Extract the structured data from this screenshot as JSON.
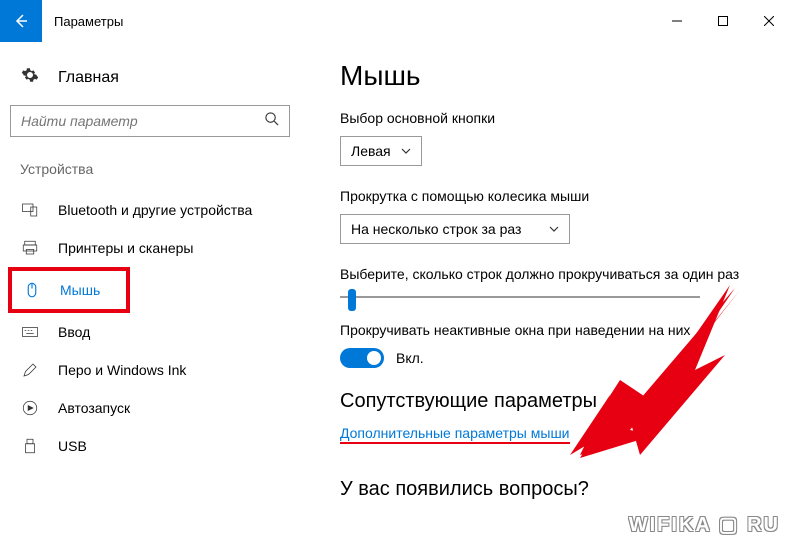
{
  "titlebar": {
    "title": "Параметры"
  },
  "sidebar": {
    "home_label": "Главная",
    "search_placeholder": "Найти параметр",
    "category": "Устройства",
    "items": [
      {
        "label": "Bluetooth и другие устройства"
      },
      {
        "label": "Принтеры и сканеры"
      },
      {
        "label": "Мышь"
      },
      {
        "label": "Ввод"
      },
      {
        "label": "Перо и Windows Ink"
      },
      {
        "label": "Автозапуск"
      },
      {
        "label": "USB"
      }
    ]
  },
  "main": {
    "heading": "Мышь",
    "primary_button_label": "Выбор основной кнопки",
    "primary_button_value": "Левая",
    "scroll_wheel_label": "Прокрутка с помощью колесика мыши",
    "scroll_wheel_value": "На несколько строк за раз",
    "lines_label": "Выберите, сколько строк должно прокручиваться за один раз",
    "inactive_label": "Прокручивать неактивные окна при наведении на них",
    "toggle_value": "Вкл.",
    "related_heading": "Сопутствующие параметры",
    "related_link": "Дополнительные параметры мыши",
    "feedback_heading": "У вас появились вопросы?"
  },
  "watermark": "WIFIKA ▢ RU"
}
